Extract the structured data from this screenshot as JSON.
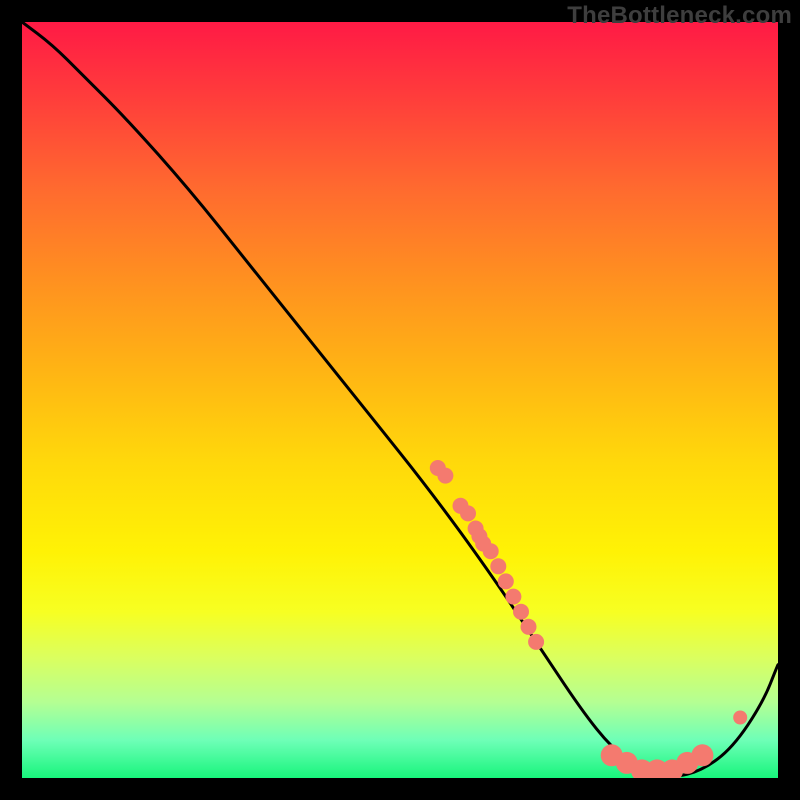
{
  "watermark": "TheBottleneck.com",
  "chart_data": {
    "type": "line",
    "title": "",
    "xlabel": "",
    "ylabel": "",
    "xlim": [
      0,
      100
    ],
    "ylim": [
      0,
      100
    ],
    "grid": false,
    "legend": false,
    "background": "red-yellow-green vertical gradient",
    "series": [
      {
        "name": "bottleneck-curve",
        "x": [
          0,
          4,
          8,
          14,
          22,
          30,
          38,
          46,
          54,
          62,
          68,
          74,
          78,
          82,
          86,
          90,
          94,
          98,
          100
        ],
        "y": [
          100,
          97,
          93,
          87,
          78,
          68,
          58,
          48,
          38,
          27,
          18,
          9,
          4,
          1,
          0,
          1,
          4,
          10,
          15
        ]
      }
    ],
    "scatter_points": [
      {
        "x": 55,
        "y": 41
      },
      {
        "x": 56,
        "y": 40
      },
      {
        "x": 58,
        "y": 36
      },
      {
        "x": 59,
        "y": 35
      },
      {
        "x": 60,
        "y": 33
      },
      {
        "x": 60.5,
        "y": 32
      },
      {
        "x": 61,
        "y": 31
      },
      {
        "x": 62,
        "y": 30
      },
      {
        "x": 63,
        "y": 28
      },
      {
        "x": 64,
        "y": 26
      },
      {
        "x": 65,
        "y": 24
      },
      {
        "x": 66,
        "y": 22
      },
      {
        "x": 67,
        "y": 20
      },
      {
        "x": 68,
        "y": 18
      },
      {
        "x": 78,
        "y": 3
      },
      {
        "x": 80,
        "y": 2
      },
      {
        "x": 82,
        "y": 1
      },
      {
        "x": 84,
        "y": 1
      },
      {
        "x": 86,
        "y": 1
      },
      {
        "x": 88,
        "y": 2
      },
      {
        "x": 90,
        "y": 3
      },
      {
        "x": 95,
        "y": 8
      }
    ],
    "colors": {
      "curve": "#000000",
      "dots": "#f47a6f",
      "gradient_top": "#ff1a45",
      "gradient_mid": "#fff205",
      "gradient_bottom": "#18f57c"
    }
  }
}
